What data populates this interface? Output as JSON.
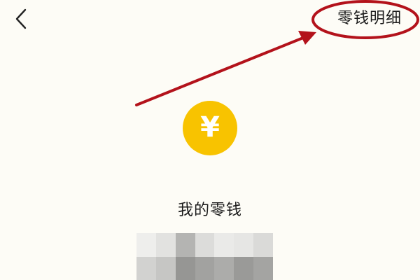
{
  "header": {
    "back_icon": "chevron-left-icon",
    "detail_link": "零钱明细"
  },
  "main": {
    "coin_symbol": "¥",
    "title": "我的零钱"
  },
  "colors": {
    "background": "#fdfcf6",
    "coin": "#f8c300",
    "annotation": "#b3121b"
  },
  "balance": {
    "obscured": true,
    "mosaic_colors": [
      "#eeeeec",
      "#e2e2e0",
      "#b4b4b2",
      "#dcdcda",
      "#eaeae8",
      "#e6e6e4",
      "#dadad8",
      "#d2d2d0",
      "#c6c6c4",
      "#969694",
      "#a2a2a0",
      "#acacaa",
      "#9a9a98",
      "#a4a4a2"
    ]
  }
}
